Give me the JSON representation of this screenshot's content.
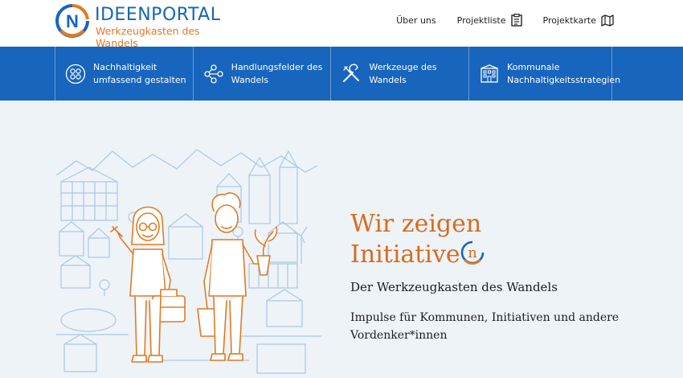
{
  "header": {
    "logo_title": "IDEENPORTAL",
    "logo_subtitle": "Werkzeugkasten des Wandels",
    "logo_letter": "N",
    "nav": [
      {
        "label": "Über uns",
        "icon": ""
      },
      {
        "label": "Projektliste",
        "icon": "clipboard-list-icon"
      },
      {
        "label": "Projektkarte",
        "icon": "map-icon"
      }
    ]
  },
  "band": {
    "items": [
      {
        "label": "Nachhaltigkeit umfassend gestalten",
        "icon": "circles-grid-icon"
      },
      {
        "label": "Handlungsfelder des Wandels",
        "icon": "network-icon"
      },
      {
        "label": "Werkzeuge des Wandels",
        "icon": "tools-icon"
      },
      {
        "label": "Kommunale Nachhaltigkeitsstrategien",
        "icon": "building-icon"
      }
    ]
  },
  "hero": {
    "headline_line1": "Wir zeigen",
    "headline_line2": "Initiative",
    "headline_letter": "n",
    "subtitle": "Der Werkzeugkasten des Wandels",
    "description": "Impulse für Kommunen, Initiativen und andere Vordenker*innen"
  },
  "colors": {
    "brand_blue": "#1765bd",
    "brand_orange": "#e07a22",
    "background": "#eef3f8"
  }
}
